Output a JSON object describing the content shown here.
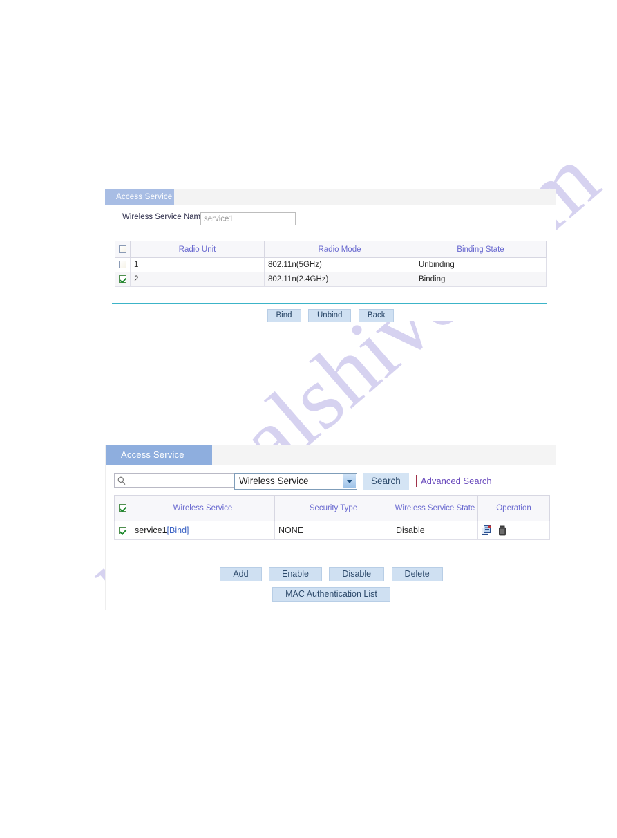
{
  "bind_panel": {
    "tab_label": "Access Service",
    "field": {
      "label": "Wireless Service Name",
      "value": "service1"
    },
    "table": {
      "headers": [
        "Radio Unit",
        "Radio Mode",
        "Binding State"
      ],
      "header_checkbox_checked": false,
      "rows": [
        {
          "checked": false,
          "radio_unit": "1",
          "radio_mode": "802.11n(5GHz)",
          "binding_state": "Unbinding"
        },
        {
          "checked": true,
          "radio_unit": "2",
          "radio_mode": "802.11n(2.4GHz)",
          "binding_state": "Binding"
        }
      ]
    },
    "buttons": [
      "Bind",
      "Unbind",
      "Back"
    ]
  },
  "list_panel": {
    "tab_label": "Access Service",
    "search": {
      "query": "",
      "placeholder": "",
      "field_selected": "Wireless Service",
      "search_button": "Search",
      "advanced_link": "Advanced Search"
    },
    "table": {
      "headers": [
        "Wireless Service",
        "Security Type",
        "Wireless Service State",
        "Operation"
      ],
      "header_checkbox_checked": true,
      "rows": [
        {
          "checked": true,
          "service_name": "service1",
          "service_bind": "[Bind]",
          "security_type": "NONE",
          "service_state": "Disable",
          "operations": [
            "edit-icon",
            "delete-icon"
          ]
        }
      ]
    },
    "buttons_row1": [
      "Add",
      "Enable",
      "Disable",
      "Delete"
    ],
    "buttons_row2": [
      "MAC Authentication List"
    ]
  },
  "watermark": {
    "text": "manualshive.com"
  },
  "colors": {
    "tab_blue": "#a8bde4",
    "tab_blue_strong": "#8eaede",
    "header_text": "#6a6ad0",
    "divider_teal": "#3cb4c8",
    "button_blue": "#cfe0f2",
    "link_purple": "#6a4bbd",
    "link_blue": "#3a62c4",
    "state_text": "#4b2340",
    "watermark": "#cfcbee"
  }
}
